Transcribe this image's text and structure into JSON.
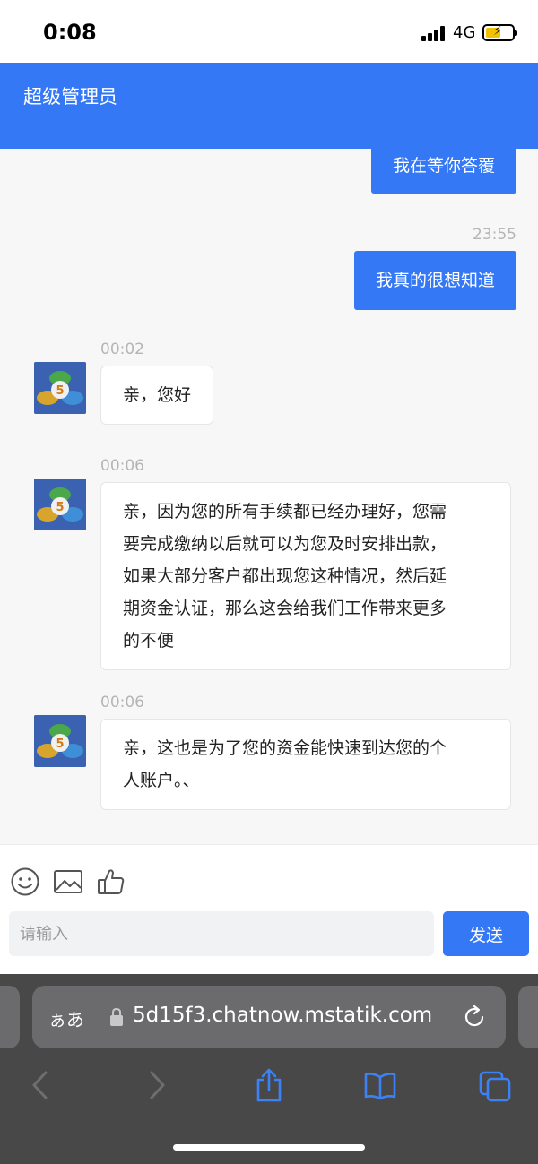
{
  "status_bar": {
    "time": "0:08",
    "network": "4G"
  },
  "header": {
    "title": "超级管理员"
  },
  "messages": [
    {
      "type": "outgoing",
      "text": "我在等你答覆"
    },
    {
      "type": "outgoing",
      "timestamp": "23:55",
      "text": "我真的很想知道"
    },
    {
      "type": "incoming",
      "timestamp": "00:02",
      "lines": [
        "亲，您好"
      ]
    },
    {
      "type": "incoming",
      "timestamp": "00:06",
      "lines": [
        "亲，因为您的所有手续都已经办理好，您需",
        "要完成缴纳以后就可以为您及时安排出款，",
        "如果大部分客户都出现您这种情况，然后延",
        "期资金认证，那么这会给我们工作带来更多",
        "的不便"
      ]
    },
    {
      "type": "incoming",
      "timestamp": "00:06",
      "lines": [
        "亲，这也是为了您的资金能快速到达您的个",
        "人账户。、"
      ]
    }
  ],
  "input": {
    "placeholder": "请输入",
    "value": ""
  },
  "send_button": "发送",
  "browser": {
    "aa_label": "ぁあ",
    "url": "5d15f3.chatnow.mstatik.com"
  },
  "icons": [
    "emoji-icon",
    "image-icon",
    "thumbs-up-icon",
    "lock-icon",
    "reload-icon",
    "back-icon",
    "forward-icon",
    "share-icon",
    "bookmarks-icon",
    "tabs-icon"
  ],
  "colors": {
    "accent": "#3478f6",
    "browser_bg": "#484849",
    "browser_icon": "#3b82f6"
  }
}
